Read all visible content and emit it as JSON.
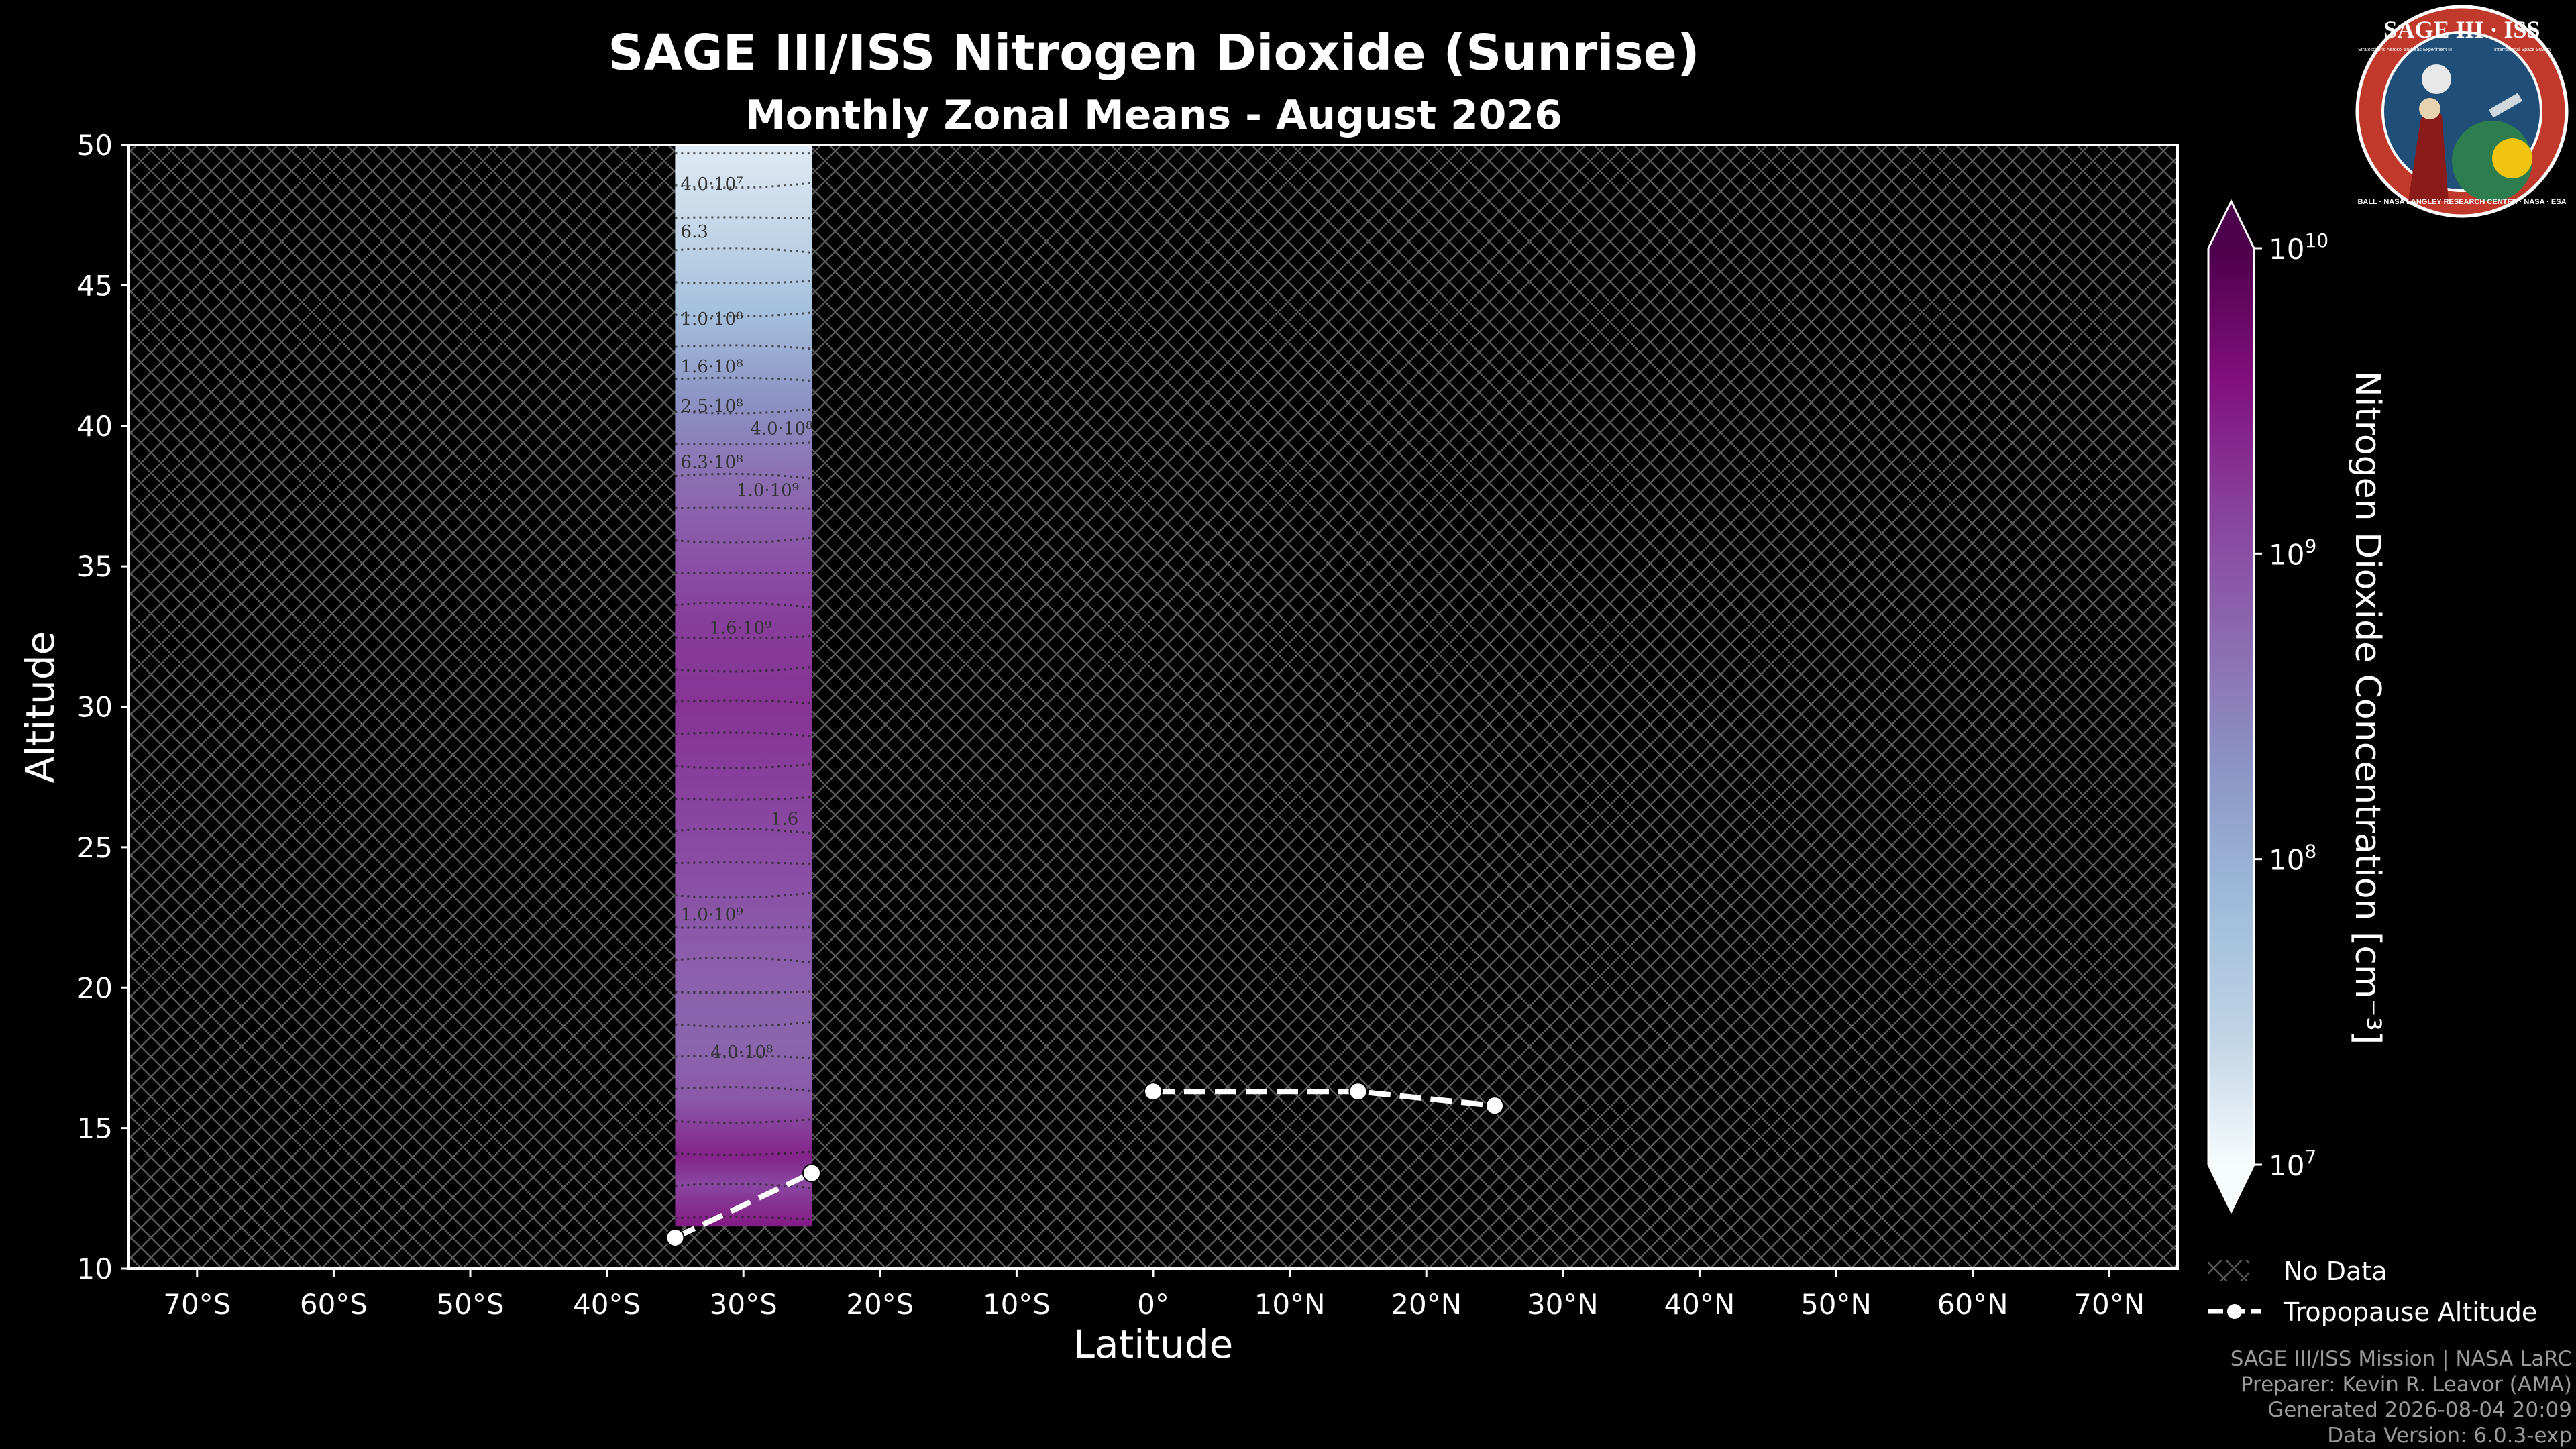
{
  "title": "SAGE III/ISS Nitrogen Dioxide (Sunrise)",
  "subtitle": "Monthly Zonal Means - August 2026",
  "logo": {
    "top_text": "SAGE III · ISS",
    "ring_text": "BALL · NASA LANGLEY RESEARCH CENTER · NASA · ESA",
    "left_caption": "Stratospheric Aerosol and Gas Experiment III",
    "right_caption": "International Space Station",
    "colors": {
      "ring": "#c0392b",
      "inner": "#1f4e79",
      "robe": "#8b1a1a"
    }
  },
  "footer": [
    "SAGE III/ISS Mission | NASA LaRC",
    "Preparer: Kevin R. Leavor (AMA)",
    "Generated 2026-08-04 20:09",
    "Data Version: 6.0.3-exp"
  ],
  "legend": {
    "no_data": "No Data",
    "tropopause": "Tropopause Altitude"
  },
  "colorbar": {
    "label": "Nitrogen Dioxide Concentration [cm⁻³]",
    "scale": "log",
    "min": 10000000,
    "max": 10000000000,
    "extend": "both",
    "ticks": [
      {
        "value": 10000000,
        "base": "10",
        "exp": "7"
      },
      {
        "value": 100000000,
        "base": "10",
        "exp": "8"
      },
      {
        "value": 1000000000,
        "base": "10",
        "exp": "9"
      },
      {
        "value": 10000000000,
        "base": "10",
        "exp": "10"
      }
    ],
    "colors": [
      "#f7fcfd",
      "#bfd3e6",
      "#9ebcda",
      "#8c96c6",
      "#8c6bb1",
      "#88419d",
      "#810f7c",
      "#4d004b"
    ]
  },
  "chart_data": {
    "type": "heatmap",
    "xlabel": "Latitude",
    "ylabel": "Altitude",
    "xlim": [
      -75,
      75
    ],
    "ylim": [
      10,
      50
    ],
    "grid": false,
    "xticks": [
      {
        "value": -70,
        "label": "70°S"
      },
      {
        "value": -60,
        "label": "60°S"
      },
      {
        "value": -50,
        "label": "50°S"
      },
      {
        "value": -40,
        "label": "40°S"
      },
      {
        "value": -30,
        "label": "30°S"
      },
      {
        "value": -20,
        "label": "20°S"
      },
      {
        "value": -10,
        "label": "10°S"
      },
      {
        "value": 0,
        "label": "0°"
      },
      {
        "value": 10,
        "label": "10°N"
      },
      {
        "value": 20,
        "label": "20°N"
      },
      {
        "value": 30,
        "label": "30°N"
      },
      {
        "value": 40,
        "label": "40°N"
      },
      {
        "value": 50,
        "label": "50°N"
      },
      {
        "value": 60,
        "label": "60°N"
      },
      {
        "value": 70,
        "label": "70°N"
      }
    ],
    "yticks": [
      {
        "value": 10,
        "label": "10"
      },
      {
        "value": 15,
        "label": "15"
      },
      {
        "value": 20,
        "label": "20"
      },
      {
        "value": 25,
        "label": "25"
      },
      {
        "value": 30,
        "label": "30"
      },
      {
        "value": 35,
        "label": "35"
      },
      {
        "value": 40,
        "label": "40"
      },
      {
        "value": 45,
        "label": "45"
      },
      {
        "value": 50,
        "label": "50"
      }
    ],
    "data_region": {
      "lat_min": -35,
      "lat_max": -25,
      "alt_min": 11.5,
      "alt_max": 50
    },
    "profile": [
      {
        "alt": 50,
        "value": 15000000
      },
      {
        "alt": 47,
        "value": 25000000
      },
      {
        "alt": 44,
        "value": 60000000
      },
      {
        "alt": 41,
        "value": 200000000
      },
      {
        "alt": 38,
        "value": 500000000
      },
      {
        "alt": 35,
        "value": 1000000000
      },
      {
        "alt": 33,
        "value": 1500000000
      },
      {
        "alt": 30,
        "value": 1800000000
      },
      {
        "alt": 27,
        "value": 1400000000
      },
      {
        "alt": 24,
        "value": 1000000000
      },
      {
        "alt": 21,
        "value": 700000000
      },
      {
        "alt": 18,
        "value": 600000000
      },
      {
        "alt": 16,
        "value": 800000000
      },
      {
        "alt": 14,
        "value": 2500000000
      },
      {
        "alt": 13,
        "value": 1200000000
      },
      {
        "alt": 11.5,
        "value": 3000000000
      }
    ],
    "contour_labels": [
      {
        "lat": -34.6,
        "alt": 48.4,
        "text": "4.0·10⁷"
      },
      {
        "lat": -34.6,
        "alt": 46.7,
        "text": "6.3"
      },
      {
        "lat": -34.6,
        "alt": 43.6,
        "text": "1.0·10⁸"
      },
      {
        "lat": -34.6,
        "alt": 41.9,
        "text": "1.6·10⁸"
      },
      {
        "lat": -34.6,
        "alt": 40.5,
        "text": "2.5·10⁸"
      },
      {
        "lat": -29.5,
        "alt": 39.7,
        "text": "4.0·10⁸"
      },
      {
        "lat": -34.6,
        "alt": 38.5,
        "text": "6.3·10⁸"
      },
      {
        "lat": -30.5,
        "alt": 37.5,
        "text": "1.0·10⁹"
      },
      {
        "lat": -32.5,
        "alt": 32.6,
        "text": "1.6·10⁹"
      },
      {
        "lat": -28,
        "alt": 25.8,
        "text": "1.6"
      },
      {
        "lat": -34.6,
        "alt": 22.4,
        "text": "1.0·10⁹"
      },
      {
        "lat": -32.4,
        "alt": 17.5,
        "text": "4.0·10⁸"
      }
    ],
    "series": [
      {
        "name": "Tropopause Altitude",
        "style": "dashed",
        "color": "#ffffff",
        "x": [
          -35,
          -25
        ],
        "y": [
          11.1,
          13.4
        ]
      },
      {
        "name": "Tropopause Altitude",
        "style": "dashed",
        "color": "#ffffff",
        "x": [
          0,
          15,
          25
        ],
        "y": [
          16.3,
          16.3,
          15.8
        ]
      }
    ]
  }
}
